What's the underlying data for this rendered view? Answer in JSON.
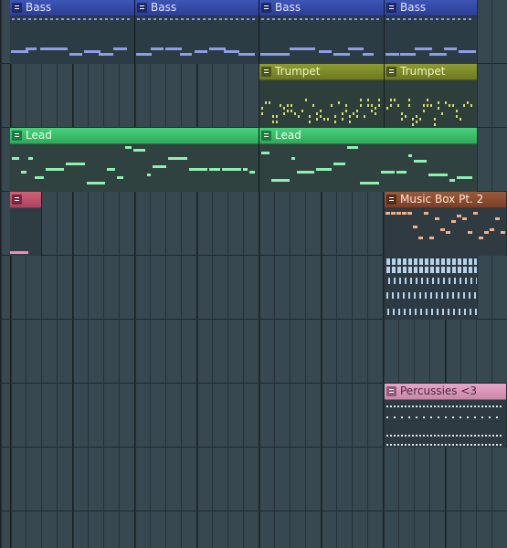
{
  "playlist": {
    "clips": [
      {
        "id": "bass-1",
        "label": "Bass",
        "color": "#3e55b8"
      },
      {
        "id": "bass-2",
        "label": "Bass",
        "color": "#3e55b8"
      },
      {
        "id": "bass-3",
        "label": "Bass",
        "color": "#3e55b8"
      },
      {
        "id": "bass-4",
        "label": "Bass",
        "color": "#3e55b8"
      },
      {
        "id": "trumpet-1",
        "label": "Trumpet",
        "color": "#8e9a32"
      },
      {
        "id": "trumpet-2",
        "label": "Trumpet",
        "color": "#8e9a32"
      },
      {
        "id": "lead-1",
        "label": "Lead",
        "color": "#48d07a"
      },
      {
        "id": "lead-2",
        "label": "Lead",
        "color": "#48d07a"
      },
      {
        "id": "pink-1",
        "label": "",
        "color": "#d0607a"
      },
      {
        "id": "music-box",
        "label": "Music Box Pt. 2",
        "color": "#9a5a3c"
      },
      {
        "id": "drums",
        "label": "",
        "color": "#3f6f95"
      },
      {
        "id": "perc",
        "label": "Percussies <3",
        "color": "#e6a6c4"
      }
    ]
  }
}
